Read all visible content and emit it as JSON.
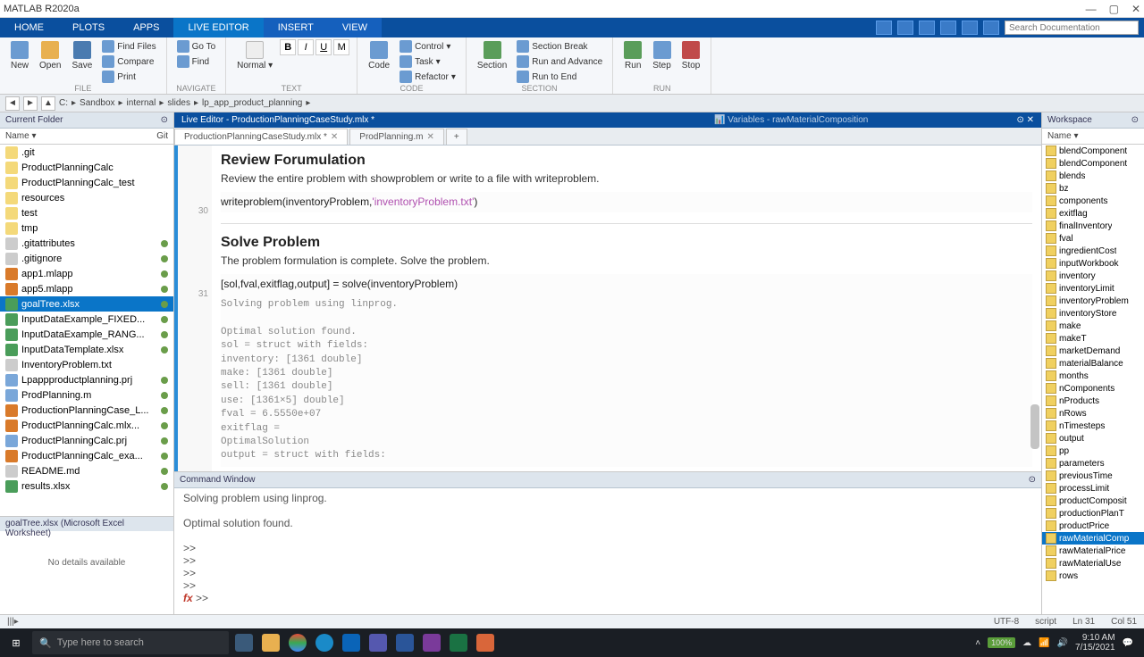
{
  "titlebar": {
    "title": "MATLAB R2020a"
  },
  "ribtabs": [
    "HOME",
    "PLOTS",
    "APPS",
    "LIVE EDITOR",
    "INSERT",
    "VIEW"
  ],
  "ribtabs_active": 3,
  "qat_search_placeholder": "Search Documentation",
  "ribbon_groups": {
    "file": {
      "label": "FILE",
      "new": "New",
      "open": "Open",
      "save": "Save",
      "findfiles": "Find Files",
      "compare": "Compare",
      "print": "Print"
    },
    "navigate": {
      "label": "NAVIGATE",
      "goto": "Go To",
      "find": "Find"
    },
    "text": {
      "label": "TEXT",
      "btnB": "B",
      "btnI": "I",
      "btnU": "U",
      "btnM": "M"
    },
    "code": {
      "label": "CODE",
      "code": "Code",
      "ctrl": "Control",
      "task": "Task",
      "refactor": "Refactor"
    },
    "section": {
      "label": "SECTION",
      "sec": "Section",
      "break": "Section Break",
      "runabove": "Run and Advance",
      "runend": "Run to End"
    },
    "run": {
      "label": "RUN",
      "run": "Run",
      "step": "Step",
      "stop": "Stop"
    }
  },
  "pathbar": {
    "segs": [
      "C:",
      "Sandbox",
      "internal",
      "slides",
      "lp_app_product_planning"
    ]
  },
  "left": {
    "hdr": "Current Folder",
    "colhdr": "Name ▾",
    "git": "Git",
    "files": [
      {
        "n": ".git",
        "t": "fold"
      },
      {
        "n": "ProductPlanningCalc",
        "t": "fold"
      },
      {
        "n": "ProductPlanningCalc_test",
        "t": "fold"
      },
      {
        "n": "resources",
        "t": "fold"
      },
      {
        "n": "test",
        "t": "fold"
      },
      {
        "n": "tmp",
        "t": "fold"
      },
      {
        "n": ".gitattributes",
        "t": "txt",
        "d": true
      },
      {
        "n": ".gitignore",
        "t": "txt",
        "d": true
      },
      {
        "n": "app1.mlapp",
        "t": "mlx",
        "d": true
      },
      {
        "n": "app5.mlapp",
        "t": "mlx",
        "d": true
      },
      {
        "n": "goalTree.xlsx",
        "t": "xls",
        "d": true,
        "sel": true
      },
      {
        "n": "InputDataExample_FIXED...",
        "t": "xls",
        "d": true
      },
      {
        "n": "InputDataExample_RANG...",
        "t": "xls",
        "d": true
      },
      {
        "n": "InputDataTemplate.xlsx",
        "t": "xls",
        "d": true
      },
      {
        "n": "InventoryProblem.txt",
        "t": "txt"
      },
      {
        "n": "Lpappproductplanning.prj",
        "t": "m",
        "d": true
      },
      {
        "n": "ProdPlanning.m",
        "t": "m",
        "d": true
      },
      {
        "n": "ProductionPlanningCase_L...",
        "t": "mlx",
        "d": true
      },
      {
        "n": "ProductPlanningCalc.mlx...",
        "t": "mlx",
        "d": true
      },
      {
        "n": "ProductPlanningCalc.prj",
        "t": "m",
        "d": true
      },
      {
        "n": "ProductPlanningCalc_exa...",
        "t": "mlx",
        "d": true
      },
      {
        "n": "README.md",
        "t": "txt",
        "d": true
      },
      {
        "n": "results.xlsx",
        "t": "xls",
        "d": true
      }
    ],
    "details_hdr": "goalTree.xlsx (Microsoft Excel Worksheet)",
    "details_body": "No details available"
  },
  "editor": {
    "title": "Live Editor - ProductionPlanningCaseStudy.mlx *",
    "tabs": [
      {
        "label": "ProductionPlanningCaseStudy.mlx *",
        "active": true
      },
      {
        "label": "ProdPlanning.m",
        "active": false
      }
    ],
    "h1": "Review Forumulation",
    "p1": "Review the entire problem with showproblem or write to a file with writeproblem.",
    "line30": "30",
    "code1_a": "writeproblem(inventoryProblem,",
    "code1_b": "'inventoryProblem.txt'",
    "code1_c": ")",
    "h2": "Solve Problem",
    "p2": "The problem formulation is complete. Solve the problem.",
    "line31": "31",
    "code2": "[sol,fval,exitflag,output] = solve(inventoryProblem)",
    "out": [
      "Solving problem using linprog.",
      "",
      "Optimal solution found.",
      "sol = struct with fields:",
      "    inventory: [1361 double]",
      "         make: [1361 double]",
      "         sell: [1361 double]",
      "          use: [1361×5] double]",
      "fval = 6.5550e+07",
      "exitflag =",
      "    OptimalSolution",
      "output = struct with fields:"
    ]
  },
  "cmd": {
    "hdr": "Command Window",
    "lines": [
      "Solving problem using linprog.",
      "",
      "Optimal solution found.",
      "",
      ">>",
      ">>",
      ">>",
      ">>"
    ],
    "fxprompt": ">>"
  },
  "ws": {
    "hdr": "Workspace",
    "col": "Name ▾",
    "vars": [
      "blendComponent",
      "blendComponent",
      "blends",
      "bz",
      "components",
      "exitflag",
      "finalInventory",
      "fval",
      "ingredientCost",
      "inputWorkbook",
      "inventory",
      "inventoryLimit",
      "inventoryProblem",
      "inventoryStore",
      "make",
      "makeT",
      "marketDemand",
      "materialBalance",
      "months",
      "nComponents",
      "nProducts",
      "nRows",
      "nTimesteps",
      "output",
      "pp",
      "parameters",
      "previousTime",
      "processLimit",
      "productComposit",
      "productionPlanT",
      "productPrice",
      "rawMaterialComp",
      "rawMaterialPrice",
      "rawMaterialUse",
      "rows"
    ],
    "sel": "rawMaterialComp"
  },
  "status": {
    "left": "|||▸",
    "utf": "UTF-8",
    "mode": "script",
    "ln": "Ln 31",
    "col": "Col 51"
  },
  "taskbar": {
    "search": "Type here to search",
    "batt": "100%",
    "time": "9:10 AM",
    "date": "7/15/2021"
  }
}
